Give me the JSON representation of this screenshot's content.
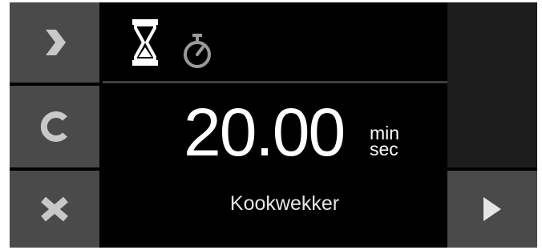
{
  "left_buttons": [
    {
      "name": "next",
      "icon": "chevron-right-icon"
    },
    {
      "name": "clear",
      "icon": "letter-c-icon"
    },
    {
      "name": "cancel",
      "icon": "x-icon"
    }
  ],
  "modes": {
    "active": "timer",
    "items": [
      {
        "name": "timer",
        "icon": "hourglass-icon"
      },
      {
        "name": "stopwatch",
        "icon": "stopwatch-icon"
      }
    ]
  },
  "timer": {
    "value": "20.00",
    "unit_top": "min",
    "unit_bottom": "sec"
  },
  "label": "Kookwekker",
  "right_buttons": {
    "play_icon": "play-icon"
  },
  "colors": {
    "background": "#000000",
    "button": "#4a4a4a",
    "icon": "#c8c8c8",
    "text": "#ffffff"
  }
}
